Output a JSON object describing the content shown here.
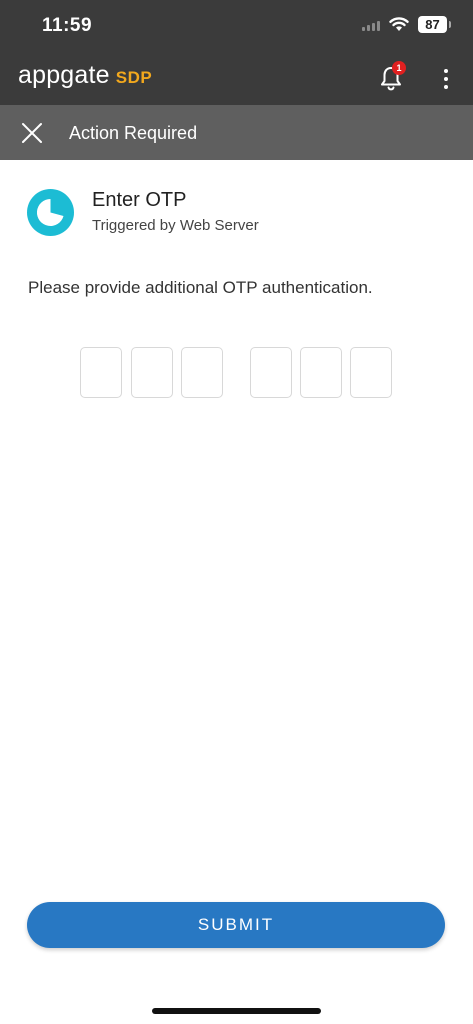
{
  "status_bar": {
    "time": "11:59",
    "battery": "87",
    "icons": [
      "signal-icon",
      "wifi-icon",
      "battery-icon"
    ]
  },
  "app_bar": {
    "brand_name": "appgate",
    "brand_product": "SDP",
    "notification_count": "1",
    "icons": [
      "bell-icon",
      "more-vertical-icon"
    ]
  },
  "sub_header": {
    "title": "Action Required",
    "icons": [
      "close-icon"
    ]
  },
  "action": {
    "title": "Enter OTP",
    "subtitle": "Triggered by Web Server",
    "icon": "pie-clock-icon"
  },
  "instruction": "Please provide additional OTP authentication.",
  "otp": {
    "digits": [
      "",
      "",
      "",
      "",
      "",
      ""
    ]
  },
  "submit_label": "SUBMIT",
  "colors": {
    "header_bg": "#3b3b3b",
    "subheader_bg": "#5f5f5f",
    "brand_accent": "#f2a81d",
    "icon_teal": "#1cbcd4",
    "primary_button": "#2878c3",
    "badge_red": "#e02020"
  }
}
